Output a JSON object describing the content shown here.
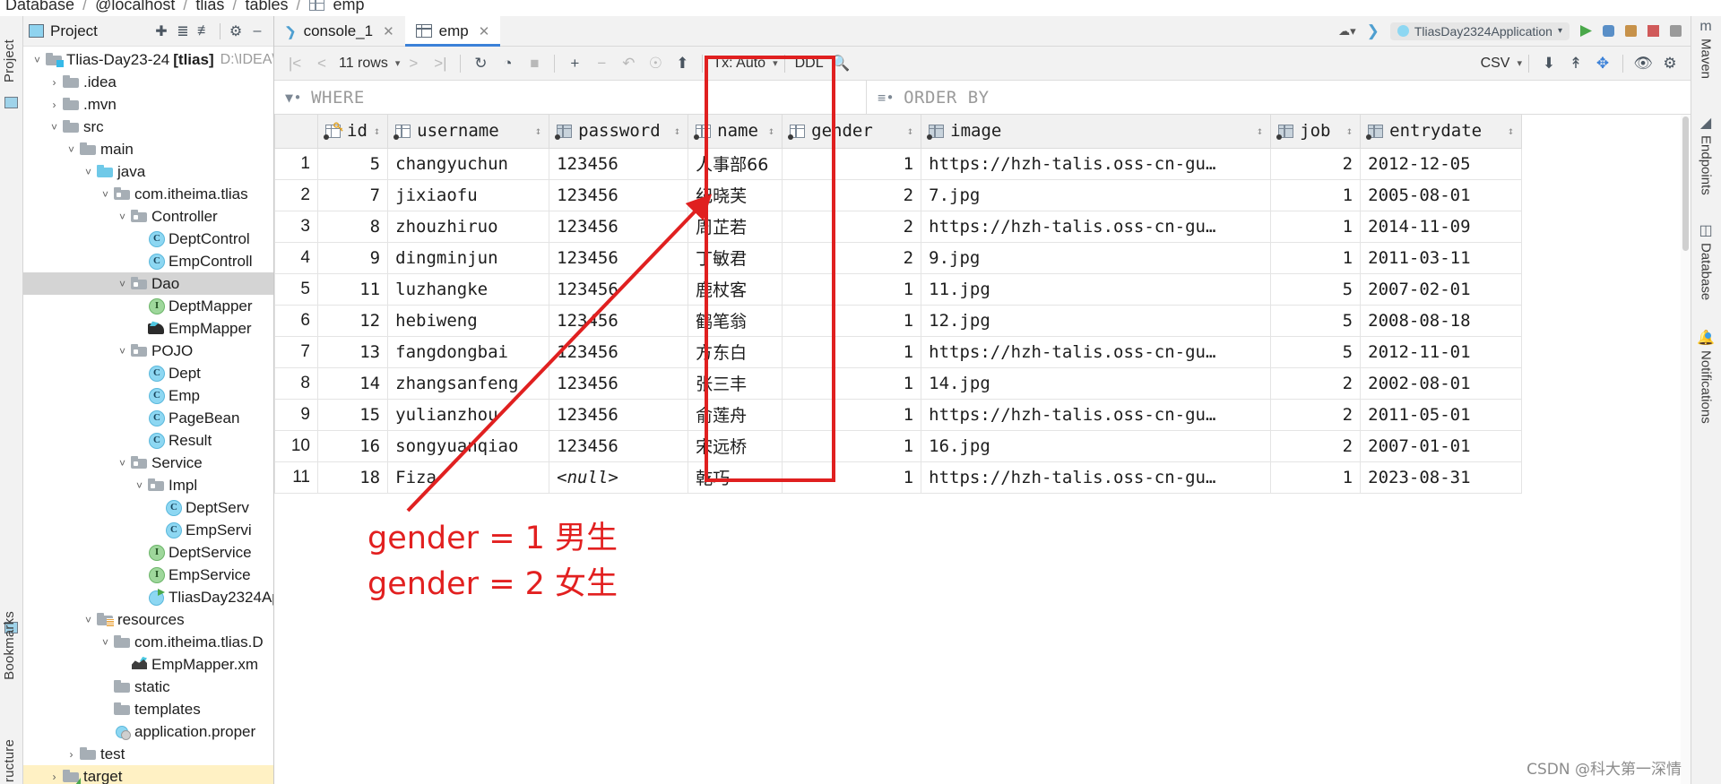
{
  "breadcrumb": {
    "items": [
      "Database",
      "@localhost",
      "tlias",
      "tables",
      "emp"
    ],
    "separator": "/"
  },
  "left_rail": {
    "labels": [
      "Project",
      "Bookmarks",
      "ructure"
    ]
  },
  "right_rail": {
    "items": [
      "Maven",
      "Endpoints",
      "Database",
      "Notifications"
    ]
  },
  "project_panel": {
    "title": "Project",
    "icons": [
      "select-opened-file-icon",
      "expand-all-icon",
      "collapse-all-icon",
      "settings-icon",
      "hide-icon"
    ],
    "tree": [
      {
        "label": "Tlias-Day23-24",
        "suffix": "[tlias]",
        "path": "D:\\IDEA\\i",
        "indent": 0,
        "chev": "v",
        "icon": "module-folder"
      },
      {
        "label": ".idea",
        "indent": 1,
        "chev": ">",
        "icon": "folder"
      },
      {
        "label": ".mvn",
        "indent": 1,
        "chev": ">",
        "icon": "folder"
      },
      {
        "label": "src",
        "indent": 1,
        "chev": "v",
        "icon": "folder"
      },
      {
        "label": "main",
        "indent": 2,
        "chev": "v",
        "icon": "folder"
      },
      {
        "label": "java",
        "indent": 3,
        "chev": "v",
        "icon": "source-folder"
      },
      {
        "label": "com.itheima.tlias",
        "indent": 4,
        "chev": "v",
        "icon": "package"
      },
      {
        "label": "Controller",
        "indent": 5,
        "chev": "v",
        "icon": "package"
      },
      {
        "label": "DeptControl",
        "indent": 6,
        "chev": "",
        "icon": "class"
      },
      {
        "label": "EmpControll",
        "indent": 6,
        "chev": "",
        "icon": "class"
      },
      {
        "label": "Dao",
        "indent": 5,
        "chev": "v",
        "icon": "package",
        "selected": true
      },
      {
        "label": "DeptMapper",
        "indent": 6,
        "chev": "",
        "icon": "interface"
      },
      {
        "label": "EmpMapper",
        "indent": 6,
        "chev": "",
        "icon": "mapper"
      },
      {
        "label": "POJO",
        "indent": 5,
        "chev": "v",
        "icon": "package"
      },
      {
        "label": "Dept",
        "indent": 6,
        "chev": "",
        "icon": "class"
      },
      {
        "label": "Emp",
        "indent": 6,
        "chev": "",
        "icon": "class"
      },
      {
        "label": "PageBean",
        "indent": 6,
        "chev": "",
        "icon": "class"
      },
      {
        "label": "Result",
        "indent": 6,
        "chev": "",
        "icon": "class"
      },
      {
        "label": "Service",
        "indent": 5,
        "chev": "v",
        "icon": "package"
      },
      {
        "label": "Impl",
        "indent": 6,
        "chev": "v",
        "icon": "package"
      },
      {
        "label": "DeptServ",
        "indent": 7,
        "chev": "",
        "icon": "class"
      },
      {
        "label": "EmpServi",
        "indent": 7,
        "chev": "",
        "icon": "class"
      },
      {
        "label": "DeptService",
        "indent": 6,
        "chev": "",
        "icon": "interface"
      },
      {
        "label": "EmpService",
        "indent": 6,
        "chev": "",
        "icon": "interface"
      },
      {
        "label": "TliasDay2324Ap",
        "indent": 6,
        "chev": "",
        "icon": "springboot"
      },
      {
        "label": "resources",
        "indent": 3,
        "chev": "v",
        "icon": "resources-folder"
      },
      {
        "label": "com.itheima.tlias.D",
        "indent": 4,
        "chev": "v",
        "icon": "folder"
      },
      {
        "label": "EmpMapper.xm",
        "indent": 5,
        "chev": "",
        "icon": "xml"
      },
      {
        "label": "static",
        "indent": 4,
        "chev": "",
        "icon": "folder"
      },
      {
        "label": "templates",
        "indent": 4,
        "chev": "",
        "icon": "folder"
      },
      {
        "label": "application.proper",
        "indent": 4,
        "chev": "",
        "icon": "properties"
      },
      {
        "label": "test",
        "indent": 2,
        "chev": ">",
        "icon": "folder"
      },
      {
        "label": "target",
        "indent": 1,
        "chev": ">",
        "icon": "target-folder",
        "highlight": true
      }
    ]
  },
  "editor": {
    "tabs": [
      {
        "label": "console_1",
        "icon": "console-icon",
        "active": false,
        "closable": true
      },
      {
        "label": "emp",
        "icon": "table-icon",
        "active": true,
        "closable": true
      }
    ],
    "run_config": "TliasDay2324Application"
  },
  "db_toolbar": {
    "nav": {
      "first": "|<",
      "prev": "<",
      "rows_label": "11 rows",
      "next": ">",
      "last": ">|"
    },
    "buttons": [
      "reload-icon",
      "query-history-icon",
      "stop-icon",
      "add-row-icon",
      "delete-row-icon",
      "revert-icon",
      "revert-selected-icon",
      "submit-icon"
    ],
    "tx_label": "Tx: Auto",
    "ddl_label": "DDL",
    "search_icon": "search-icon",
    "export_format": "CSV",
    "right_buttons": [
      "download-icon",
      "import-icon",
      "data-extractor-icon",
      "preview-icon",
      "settings-icon"
    ]
  },
  "filter_bar": {
    "where_label": "WHERE",
    "order_label": "ORDER BY"
  },
  "grid": {
    "columns": [
      {
        "name": "id",
        "icon": "column-key-icon",
        "primary": true,
        "align": "right"
      },
      {
        "name": "username",
        "icon": "column-icon",
        "align": "left"
      },
      {
        "name": "password",
        "icon": "column-icon-filled",
        "align": "left"
      },
      {
        "name": "name",
        "icon": "column-icon",
        "align": "left"
      },
      {
        "name": "gender",
        "icon": "column-icon",
        "align": "right"
      },
      {
        "name": "image",
        "icon": "column-icon-filled",
        "align": "left"
      },
      {
        "name": "job",
        "icon": "column-icon-filled",
        "align": "right"
      },
      {
        "name": "entrydate",
        "icon": "column-icon-filled",
        "align": "left"
      }
    ],
    "rows": [
      {
        "n": "1",
        "id": "5",
        "username": "changyuchun",
        "password": "123456",
        "name": "人事部66",
        "gender": "1",
        "image": "https://hzh-talis.oss-cn-gu…",
        "job": "2",
        "entrydate": "2012-12-05"
      },
      {
        "n": "2",
        "id": "7",
        "username": "jixiaofu",
        "password": "123456",
        "name": "纪晓芙",
        "gender": "2",
        "image": "7.jpg",
        "job": "1",
        "entrydate": "2005-08-01"
      },
      {
        "n": "3",
        "id": "8",
        "username": "zhouzhiruo",
        "password": "123456",
        "name": "周芷若",
        "gender": "2",
        "image": "https://hzh-talis.oss-cn-gu…",
        "job": "1",
        "entrydate": "2014-11-09"
      },
      {
        "n": "4",
        "id": "9",
        "username": "dingminjun",
        "password": "123456",
        "name": "丁敏君",
        "gender": "2",
        "image": "9.jpg",
        "job": "1",
        "entrydate": "2011-03-11"
      },
      {
        "n": "5",
        "id": "11",
        "username": "luzhangke",
        "password": "123456",
        "name": "鹿杖客",
        "gender": "1",
        "image": "11.jpg",
        "job": "5",
        "entrydate": "2007-02-01"
      },
      {
        "n": "6",
        "id": "12",
        "username": "hebiweng",
        "password": "123456",
        "name": "鹤笔翁",
        "gender": "1",
        "image": "12.jpg",
        "job": "5",
        "entrydate": "2008-08-18"
      },
      {
        "n": "7",
        "id": "13",
        "username": "fangdongbai",
        "password": "123456",
        "name": "方东白",
        "gender": "1",
        "image": "https://hzh-talis.oss-cn-gu…",
        "job": "5",
        "entrydate": "2012-11-01"
      },
      {
        "n": "8",
        "id": "14",
        "username": "zhangsanfeng",
        "password": "123456",
        "name": "张三丰",
        "gender": "1",
        "image": "14.jpg",
        "job": "2",
        "entrydate": "2002-08-01"
      },
      {
        "n": "9",
        "id": "15",
        "username": "yulianzhou",
        "password": "123456",
        "name": "俞莲舟",
        "gender": "1",
        "image": "https://hzh-talis.oss-cn-gu…",
        "job": "2",
        "entrydate": "2011-05-01"
      },
      {
        "n": "10",
        "id": "16",
        "username": "songyuanqiao",
        "password": "123456",
        "name": "宋远桥",
        "gender": "1",
        "image": "16.jpg",
        "job": "2",
        "entrydate": "2007-01-01"
      },
      {
        "n": "11",
        "id": "18",
        "username": "Fiza",
        "password": "<null>",
        "name": "乾巧",
        "gender": "1",
        "image": "https://hzh-talis.oss-cn-gu…",
        "job": "1",
        "entrydate": "2023-08-31"
      }
    ]
  },
  "annotations": {
    "highlight_color": "#e02020",
    "line1": "gender = 1  男生",
    "line2": "gender = 2  女生"
  },
  "watermark": "CSDN @科大第一深情"
}
